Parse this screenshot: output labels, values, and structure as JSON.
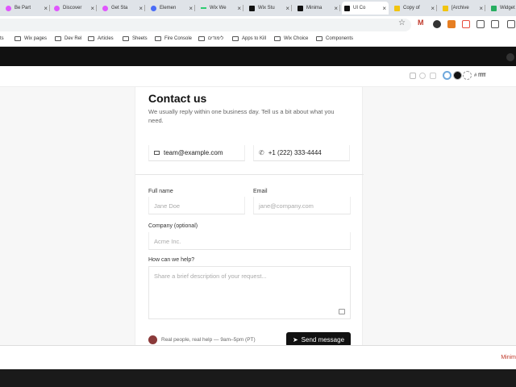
{
  "tabs": [
    {
      "label": "Be Part",
      "color": "#e056fd"
    },
    {
      "label": "Discover",
      "color": "#e056fd"
    },
    {
      "label": "Get Sta",
      "color": "#e056fd"
    },
    {
      "label": "Elemen",
      "color": "#4a6cf7"
    },
    {
      "label": "Wix We",
      "color": "#2ecc71"
    },
    {
      "label": "Wix Stu",
      "color": "#111111"
    },
    {
      "label": "Minima",
      "color": "#111111"
    },
    {
      "label": "UI Co",
      "color": "#111111"
    },
    {
      "label": "Copy of",
      "color": "#f1c40f"
    },
    {
      "label": "[Archive",
      "color": "#f1c40f"
    },
    {
      "label": "Widget",
      "color": "#27ae60"
    }
  ],
  "bookmarks": {
    "cut_label": "rts",
    "items": [
      "Wix pages",
      "Dev Rel",
      "Articles",
      "Sheets",
      "Fire Console",
      "לימודים",
      "Apps to Kill",
      "Wix Choice",
      "Components"
    ]
  },
  "toolbar": {
    "hex_value": "ffffff"
  },
  "form": {
    "title": "Contact us",
    "subtitle": "We usually reply within one business day. Tell us a bit about what you need.",
    "email_contact": "team@example.com",
    "phone_contact": "+1 (222) 333-4444",
    "full_name_label": "Full name",
    "full_name_placeholder": "Jane Doe",
    "email_label": "Email",
    "email_placeholder": "jane@company.com",
    "company_label": "Company (optional)",
    "company_placeholder": "Acme Inc.",
    "help_label": "How can we help?",
    "help_placeholder": "Share a brief description of your request...",
    "footer_note": "Real people, real help — 9am–5pm (PT)",
    "send_label": "Send message"
  },
  "bottom": {
    "right_label": "Minim"
  }
}
